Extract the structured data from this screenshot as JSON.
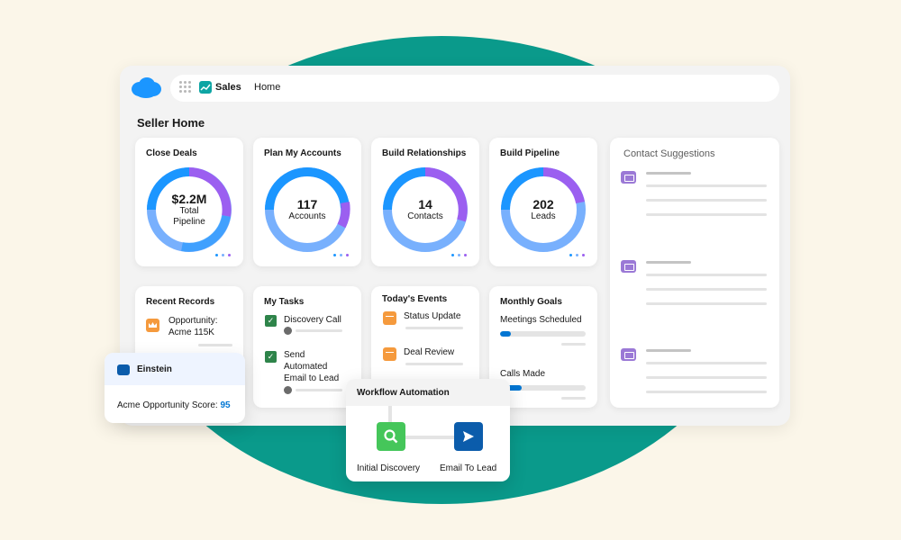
{
  "app": {
    "app_name": "Sales",
    "nav_home": "Home",
    "page_title": "Seller Home"
  },
  "metric_cards": [
    {
      "title": "Close Deals",
      "value": "$2.2M",
      "label_line1": "Total",
      "label_line2": "Pipeline"
    },
    {
      "title": "Plan My Accounts",
      "value": "117",
      "label_line1": "Accounts",
      "label_line2": ""
    },
    {
      "title": "Build Relationships",
      "value": "14",
      "label_line1": "Contacts",
      "label_line2": ""
    },
    {
      "title": "Build Pipeline",
      "value": "202",
      "label_line1": "Leads",
      "label_line2": ""
    }
  ],
  "contact_suggestions": {
    "title": "Contact Suggestions"
  },
  "recent_records": {
    "title": "Recent Records",
    "item_line1": "Opportunity:",
    "item_line2": "Acme 115K"
  },
  "tasks": {
    "title": "My Tasks",
    "items": [
      {
        "line1": "Discovery Call",
        "line2": "",
        "line3": ""
      },
      {
        "line1": "Send",
        "line2": "Automated",
        "line3": "Email to Lead"
      }
    ]
  },
  "events": {
    "title": "Today's Events",
    "items": [
      "Status Update",
      "Deal Review"
    ]
  },
  "goals": {
    "title": "Monthly Goals",
    "items": [
      {
        "label": "Meetings Scheduled",
        "progress": 0.13
      },
      {
        "label": "Calls Made",
        "progress": 0.25
      }
    ]
  },
  "einstein": {
    "title": "Einstein",
    "score_label": "Acme Opportunity Score:",
    "score_value": "95"
  },
  "workflow": {
    "title": "Workflow Automation",
    "step1": "Initial Discovery",
    "step2": "Email To Lead"
  },
  "colors": {
    "teal_bg": "#0a9a8b",
    "donut_blue": "#1b96ff",
    "donut_light_blue": "#78b0fd",
    "donut_purple": "#9b5ff0",
    "task_green": "#2e844a",
    "event_orange": "#f59a3d",
    "brand_blue": "#0176d3"
  },
  "icons": [
    "salesforce-cloud-icon",
    "app-launcher-icon",
    "sales-app-icon",
    "contact-card-icon",
    "crown-icon",
    "checkbox-icon",
    "calendar-icon",
    "einstein-icon",
    "search-icon",
    "send-icon"
  ]
}
